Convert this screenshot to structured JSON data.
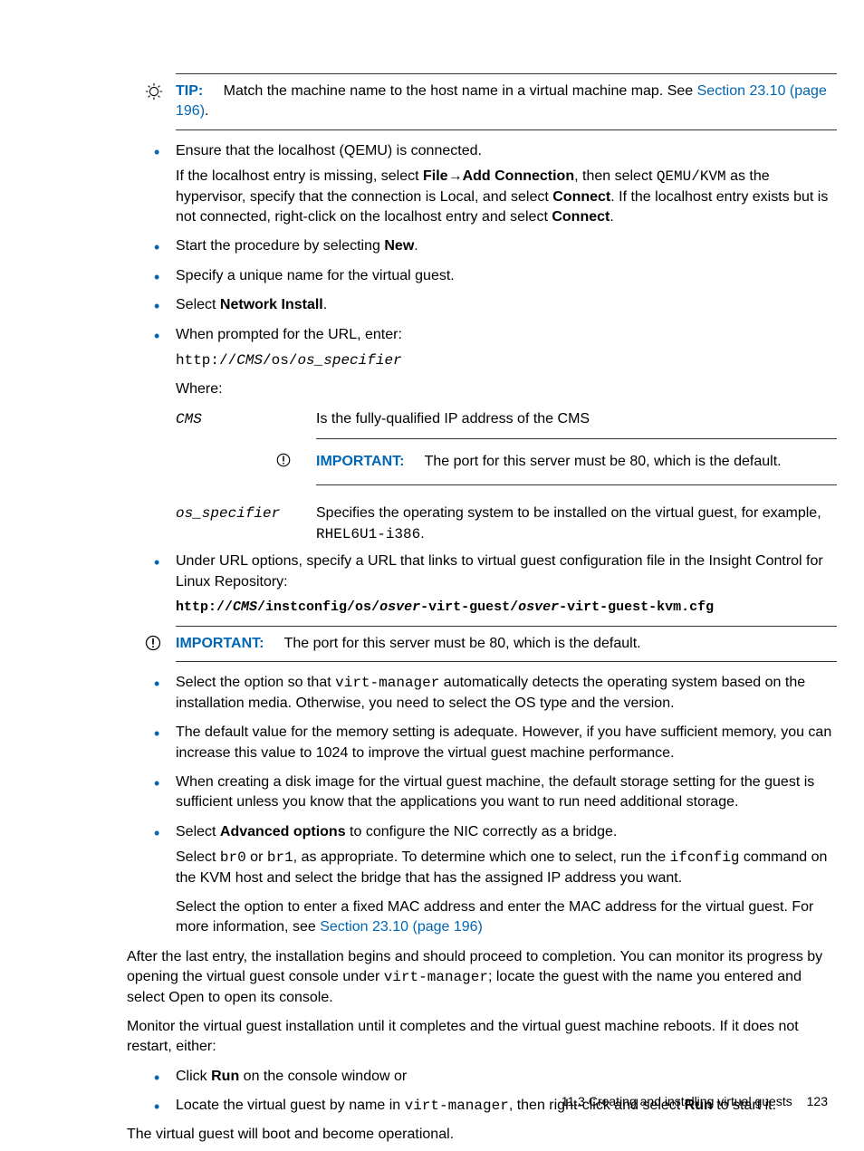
{
  "tipCallout": {
    "label": "TIP:",
    "text": "Match the machine name to the host name in a virtual machine map. See ",
    "link": "Section 23.10 (page 196)",
    "suffix": "."
  },
  "list1": {
    "ensureLocalhost": "Ensure that the localhost (QEMU) is connected.",
    "localhostP1_a": "If the localhost entry is missing, select ",
    "localhostP1_file": "File",
    "localhostP1_arrow": "→",
    "localhostP1_add": "Add Connection",
    "localhostP1_b": ", then select ",
    "localhostP1_qemu": "QEMU/KVM",
    "localhostP1_c": " as the hypervisor, specify that the connection is Local, and select ",
    "localhostP1_connect": "Connect",
    "localhostP1_d": ". If the localhost entry exists but is not connected, right-click on the localhost entry and select ",
    "localhostP1_connect2": "Connect",
    "localhostP1_e": ".",
    "startProc_a": "Start the procedure by selecting ",
    "startProc_new": "New",
    "startProc_b": ".",
    "specifyName": "Specify a unique name for the virtual guest.",
    "selectNet_a": "Select ",
    "selectNet_b": "Network Install",
    "selectNet_c": ".",
    "urlPrompt": "When prompted for the URL, enter:",
    "urlLine_a": "http://",
    "urlLine_cms": "CMS",
    "urlLine_b": "/os/",
    "urlLine_spec": "os_specifier",
    "where": "Where:",
    "def_cms_term": "CMS",
    "def_cms_body": "Is the fully-qualified IP address of the CMS",
    "def_osspec_term": "os_specifier",
    "def_osspec_a": "Specifies the operating system to be installed on the virtual guest, for example, ",
    "def_osspec_code": "RHEL6U1-i386",
    "def_osspec_b": ".",
    "urlOptions": "Under URL options, specify a URL that links to virtual guest configuration file in the Insight Control for Linux Repository:",
    "urlOpts_a": "http://",
    "urlOpts_cms": "CMS",
    "urlOpts_b": "/instconfig/os/",
    "urlOpts_osver1": "osver",
    "urlOpts_c": "-virt-guest/",
    "urlOpts_osver2": "osver",
    "urlOpts_d": "-virt-guest-kvm.cfg"
  },
  "importantInline": {
    "label": "IMPORTANT:",
    "text": "The port for this server must be 80, which is the default."
  },
  "important2": {
    "label": "IMPORTANT:",
    "text": "The port for this server must be 80, which is the default."
  },
  "list2": {
    "virtmgr_a": "Select the option so that ",
    "virtmgr_code": "virt-manager",
    "virtmgr_b": " automatically detects the operating system based on the installation media. Otherwise, you need to select the OS type and the version.",
    "memory": "The default value for the memory setting is adequate. However, if you have sufficient memory, you can increase this value to 1024 to improve the virtual guest machine performance.",
    "disk": "When creating a disk image for the virtual guest machine, the default storage setting for the guest is sufficient unless you know that the applications you want to run need additional storage.",
    "adv_a": "Select ",
    "adv_b": "Advanced options",
    "adv_c": " to configure the NIC correctly as a bridge.",
    "bridge_a": "Select ",
    "bridge_br0": "br0",
    "bridge_b": " or ",
    "bridge_br1": "br1",
    "bridge_c": ", as appropriate. To determine which one to select, run the ",
    "bridge_ifc": "ifconfig",
    "bridge_d": " command on the KVM host and select the bridge that has the assigned IP address you want.",
    "mac_a": "Select the option to enter a fixed MAC address and enter the MAC address for the virtual guest. For more information, see ",
    "mac_link": "Section 23.10 (page 196)"
  },
  "after": {
    "p1_a": "After the last entry, the installation begins and should proceed to completion. You can monitor its progress by opening the virtual guest console under ",
    "p1_code": "virt-manager",
    "p1_b": "; locate the guest with the name you entered and select Open to open its console.",
    "p2": "Monitor the virtual guest installation until it completes and the virtual guest machine reboots. If it does not restart, either:",
    "run_a": "Click ",
    "run_b": "Run",
    "run_c": " on the console window or",
    "locate_a": "Locate the virtual guest by name in ",
    "locate_code": "virt-manager",
    "locate_b": ", then right-click and select ",
    "locate_run": "Run",
    "locate_c": " to start it.",
    "p3": "The virtual guest will boot and become operational."
  },
  "footer": {
    "section": "11.3 Creating and installing virtual guests",
    "page": "123"
  }
}
